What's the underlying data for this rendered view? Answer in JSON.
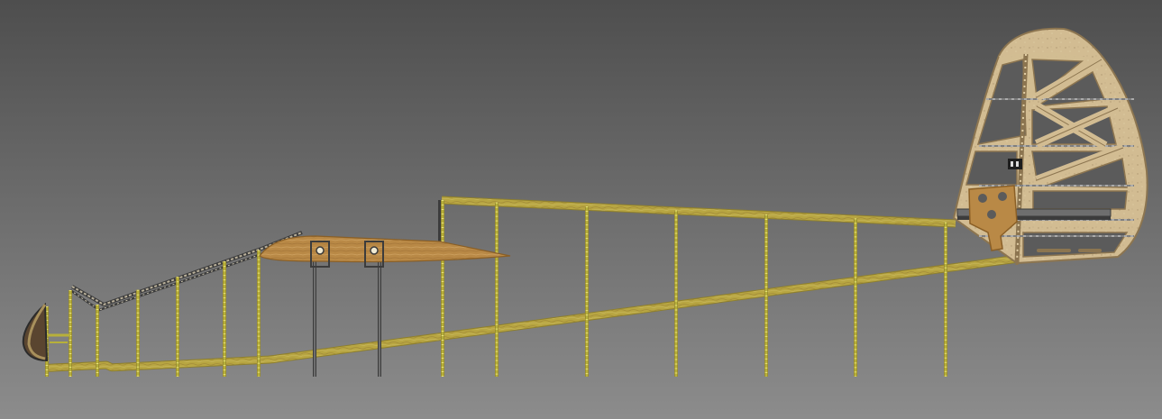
{
  "colors": {
    "background_top": "#4e4e4e",
    "background_bottom": "#8c8c8c",
    "balsa_light": "#cdbb8c",
    "balsa_dark": "#a8905c",
    "longeron": "#b8a642",
    "longeron_dark": "#8e7f2c",
    "upright": "#b7b03a",
    "upright_tick": "#e8e27a",
    "wing_rib": "#b98946",
    "wing_rib_dark": "#8a5f26",
    "tail_fill": "#d2bc92",
    "tail_edge": "#8c7550",
    "metal": "#6e6e6e",
    "metal_dark": "#3c3c3c",
    "canopy": "#5a4530"
  },
  "parts": {
    "vertical_uprights_count": 14,
    "tail_ribs_count": 6,
    "icon_names": [
      "fuselage-truss",
      "wing-root-rib",
      "vertical-fin",
      "rudder",
      "nose-former",
      "canopy-frame"
    ]
  }
}
